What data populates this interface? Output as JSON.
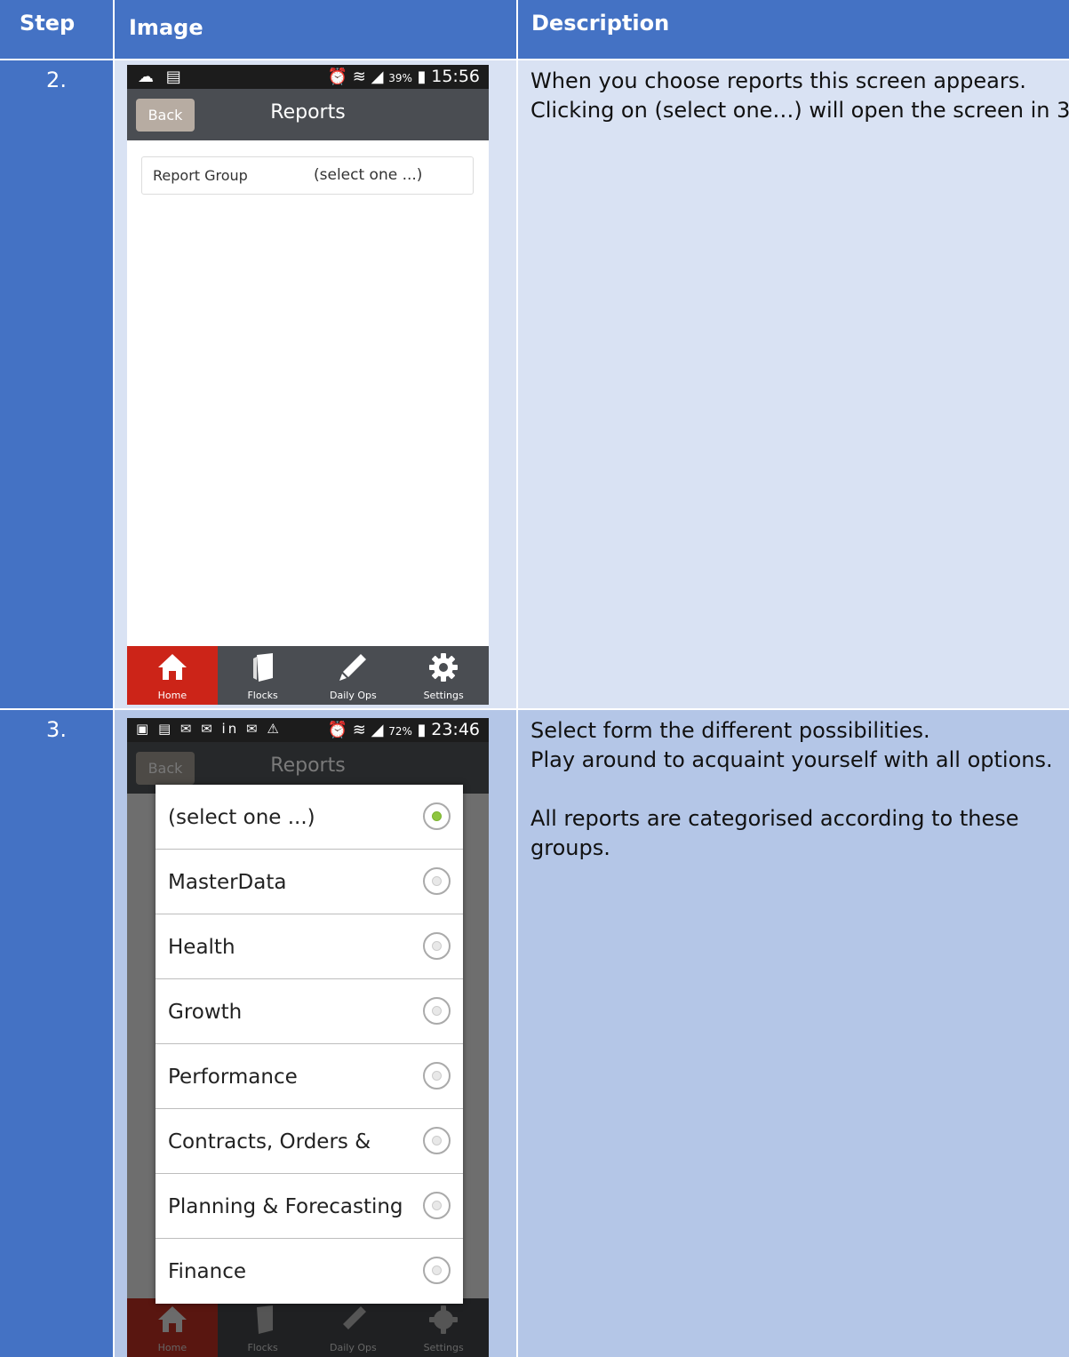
{
  "table": {
    "headers": {
      "step": "Step",
      "image": "Image",
      "description": "Description"
    }
  },
  "rows": [
    {
      "step": "2.",
      "description_lines": [
        "When you choose reports this screen appears.",
        "Clicking on (select one…) will open the screen in 3"
      ],
      "screen": {
        "status_left": "☁ ▤",
        "status_right_icons": "⏰ ≋",
        "battery_pct": "39%",
        "time": "15:56",
        "back_label": "Back",
        "title": "Reports",
        "field_label": "Report Group",
        "field_value": "(select one ...)"
      }
    },
    {
      "step": "3.",
      "description_lines": [
        "Select form the different possibilities.",
        "Play around to acquaint yourself with all options.",
        "",
        "All reports are categorised according to these",
        "groups."
      ],
      "screen": {
        "status_left": "▣ ▤ ✉ ✉ in ✉ ⚠",
        "status_right_icons": "⏰ ≋",
        "battery_pct": "72%",
        "time": "23:46",
        "back_label": "Back",
        "title": "Reports",
        "options": [
          {
            "label": "(select one ...)",
            "selected": true
          },
          {
            "label": "MasterData",
            "selected": false
          },
          {
            "label": "Health",
            "selected": false
          },
          {
            "label": "Growth",
            "selected": false
          },
          {
            "label": "Performance",
            "selected": false
          },
          {
            "label": "Contracts, Orders &",
            "selected": false
          },
          {
            "label": "Planning & Forecasting",
            "selected": false
          },
          {
            "label": "Finance",
            "selected": false
          }
        ]
      }
    }
  ],
  "tabs": [
    {
      "label": "Home",
      "icon": "home-icon"
    },
    {
      "label": "Flocks",
      "icon": "flocks-icon"
    },
    {
      "label": "Daily Ops",
      "icon": "pencil-icon"
    },
    {
      "label": "Settings",
      "icon": "gear-icon"
    }
  ],
  "colors": {
    "header_blue": "#4472c4",
    "row1_fill": "#d9e2f3",
    "row2_fill": "#b4c6e7",
    "active_tab_red": "#cc2418",
    "radio_selected_green": "#8ec63f"
  }
}
